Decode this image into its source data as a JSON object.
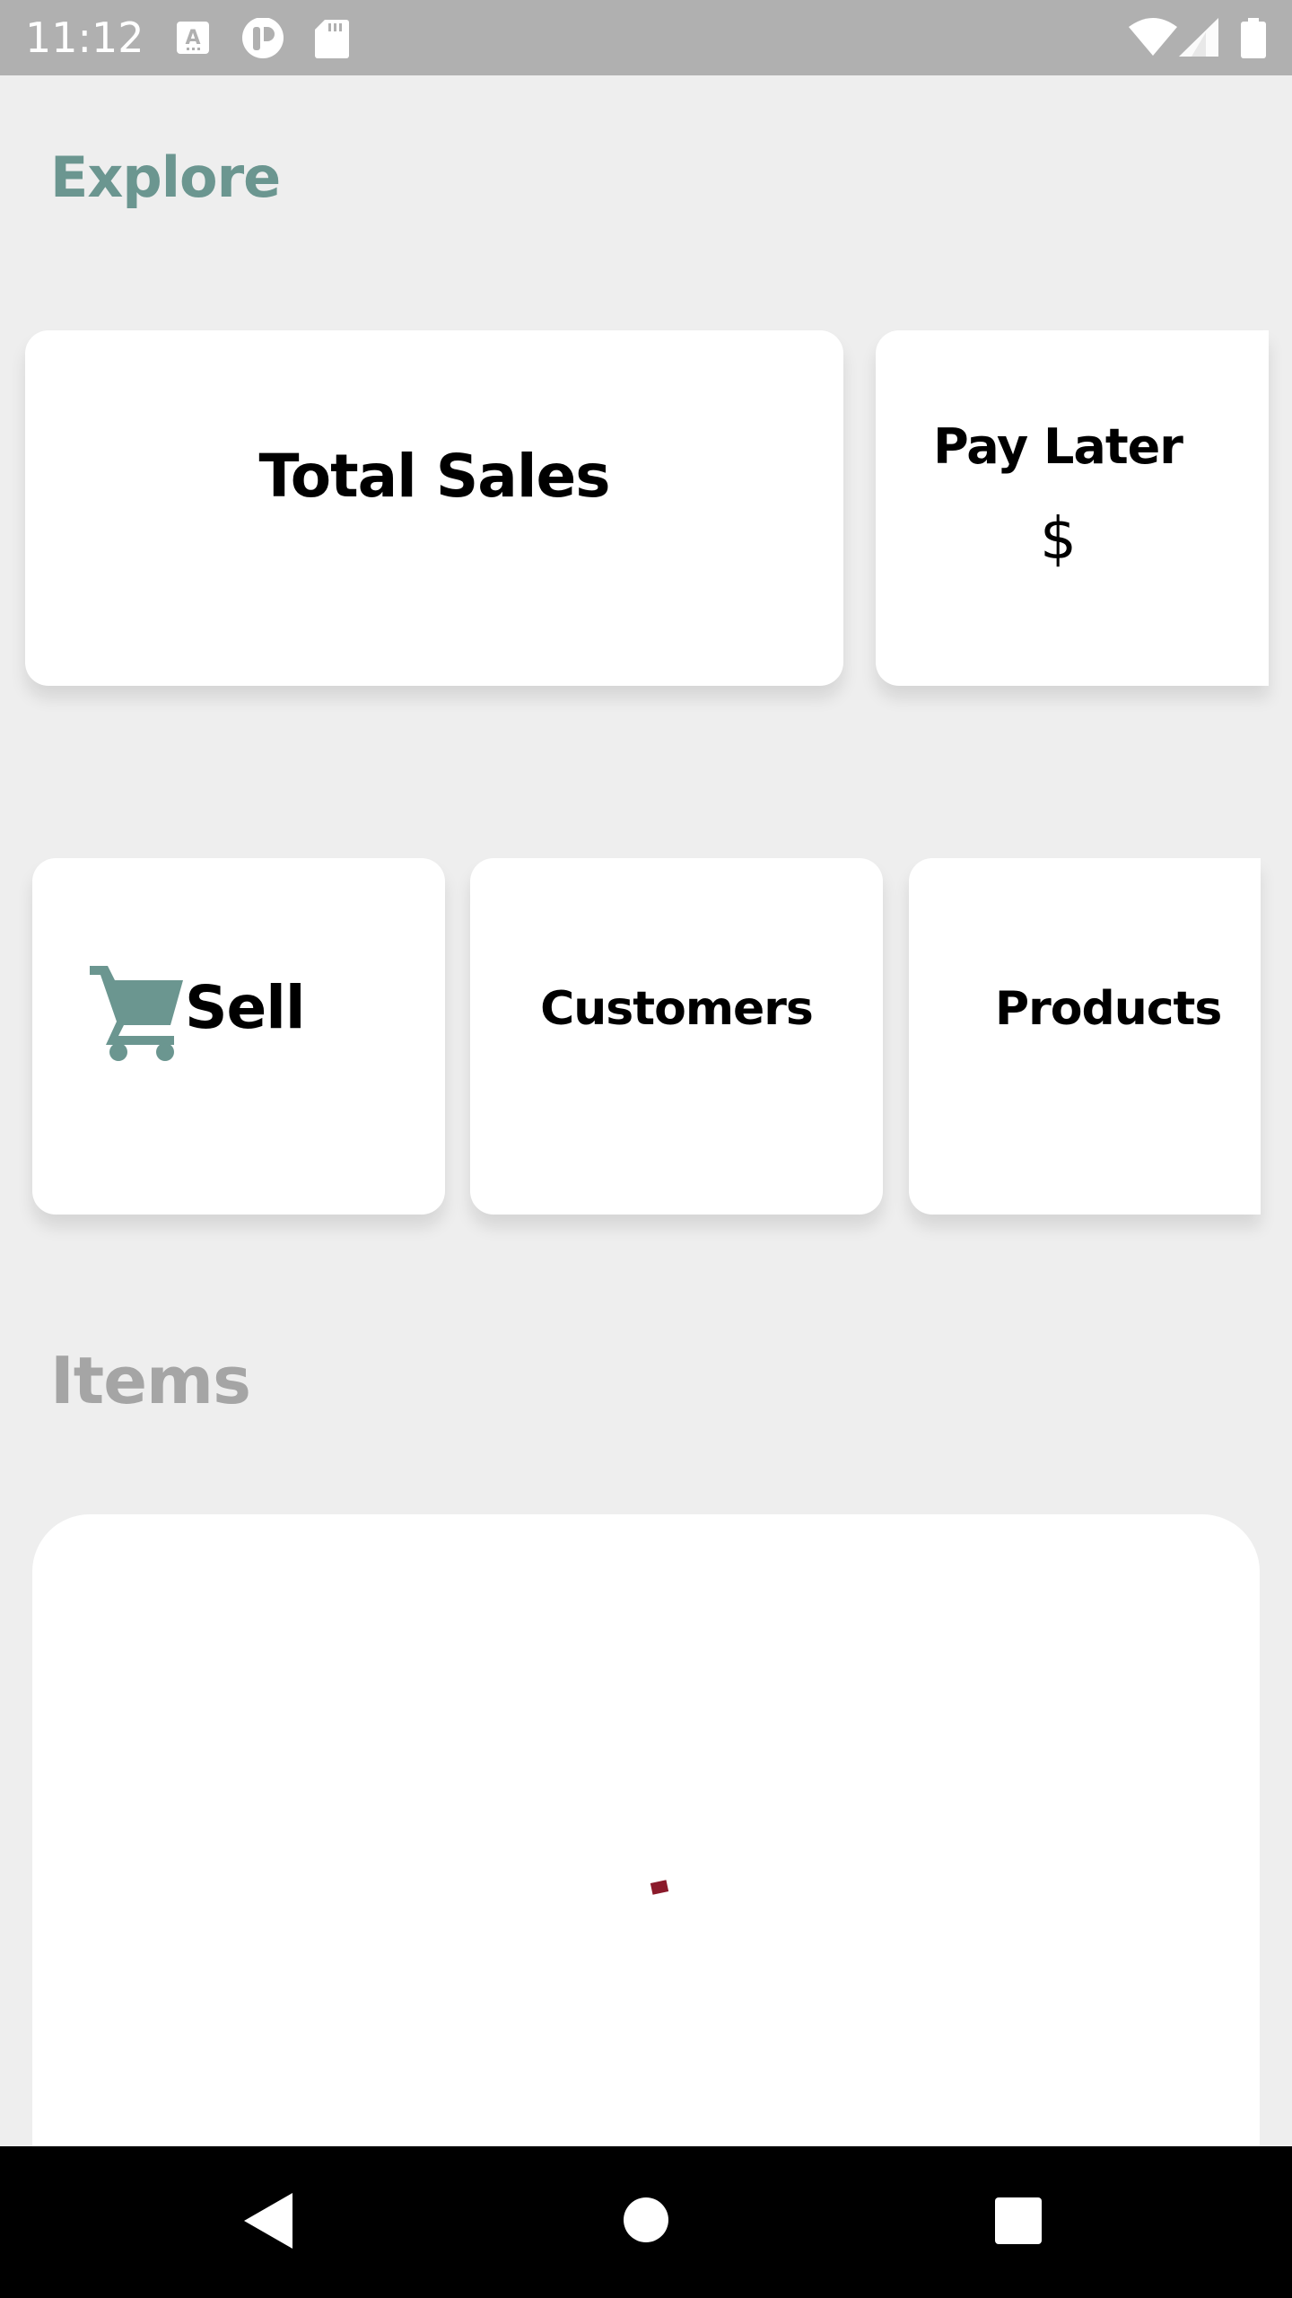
{
  "status_bar": {
    "time": "11:12",
    "icons": [
      "keyboard-a-icon",
      "record-icon",
      "sd-card-icon",
      "wifi-icon",
      "signal-icon",
      "battery-icon"
    ]
  },
  "explore_heading": {
    "text": "Explore",
    "color": "#6b9690"
  },
  "cards_row1": {
    "total_sales": {
      "label": "Total Sales"
    },
    "pay_later": {
      "label": "Pay Later",
      "value": "$"
    }
  },
  "cards_row2": {
    "sell": {
      "label": "Sell",
      "icon": "cart-icon",
      "icon_color": "#6b9690"
    },
    "customers": {
      "label": "Customers"
    },
    "products": {
      "label": "Products"
    }
  },
  "items_heading": {
    "text": "Items",
    "color": "#a5a5a5"
  },
  "loader_color": "#8b1a2b",
  "nav_bar": {
    "icons": [
      "back-icon",
      "home-icon",
      "recents-icon"
    ]
  }
}
